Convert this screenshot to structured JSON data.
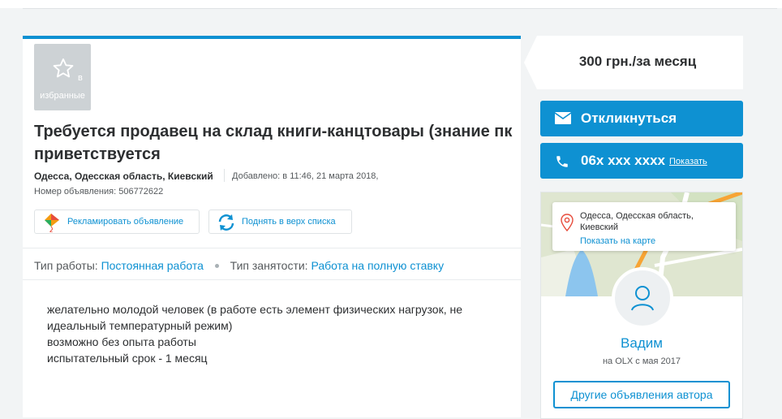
{
  "favorite": {
    "prefix": "в",
    "label": "избранные"
  },
  "listing": {
    "title": "Требуется продавец на склад книги-канцтовары (знание пк приветствуется",
    "location": "Одесса, Одесская область, Киевский",
    "added": "Добавлено: в 11:46, 21 марта 2018,",
    "ad_number": "Номер объявления: 506772622"
  },
  "promo": {
    "advertise_label": "Рекламировать объявление",
    "raise_label": "Поднять в верх списка"
  },
  "params": [
    {
      "label": "Тип работы:",
      "value": "Постоянная работа"
    },
    {
      "label": "Тип занятости:",
      "value": "Работа на полную ставку"
    }
  ],
  "description": [
    "желательно молодой человек (в работе есть элемент физических нагрузок, не",
    "идеальный температурный режим)",
    "возможно без опыта работы",
    "испытательный срок - 1 месяц"
  ],
  "price": "300 грн./за месяц",
  "contact": {
    "respond_label": "Откликнуться",
    "phone": "06x xxx xxxx",
    "show_label": "Показать"
  },
  "map": {
    "address": "Одесса, Одесская область, Киевский",
    "show_on_map": "Показать на карте"
  },
  "author": {
    "name": "Вадим",
    "since": "на OLX с мая 2017",
    "other_ads_label": "Другие объявления автора"
  },
  "colors": {
    "accent": "#0e91d2",
    "text": "#2d2f31",
    "background": "#f2f4f5"
  },
  "icons": [
    "star-icon",
    "kite-icon",
    "refresh-icon",
    "mail-icon",
    "phone-icon",
    "map-pin-icon",
    "user-icon"
  ]
}
